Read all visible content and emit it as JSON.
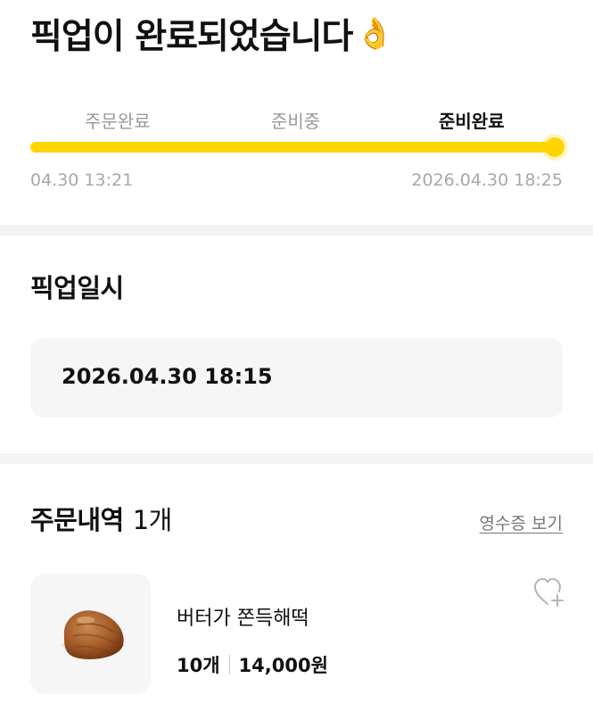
{
  "header": {
    "title": "픽업이 완료되었습니다",
    "title_emoji": "👌"
  },
  "progress": {
    "steps": [
      {
        "label": "주문완료",
        "state": "done"
      },
      {
        "label": "준비중",
        "state": "done"
      },
      {
        "label": "준비완료",
        "state": "current"
      }
    ],
    "start_time": "04.30 13:21",
    "end_time": "2026.04.30 18:25",
    "completion_fraction": 1.0,
    "accent_color": "#ffd500"
  },
  "pickup": {
    "title": "픽업일시",
    "datetime": "2026.04.30 18:15"
  },
  "order": {
    "title": "주문내역",
    "count": "1개",
    "receipt_link": "영수증 보기",
    "items": [
      {
        "name": "버터가 쫀득해떡",
        "quantity": "10개",
        "price": "14,000원",
        "image_icon": "chestnut-pastry-image",
        "wishlist_icon": "heart-plus-icon"
      }
    ]
  }
}
